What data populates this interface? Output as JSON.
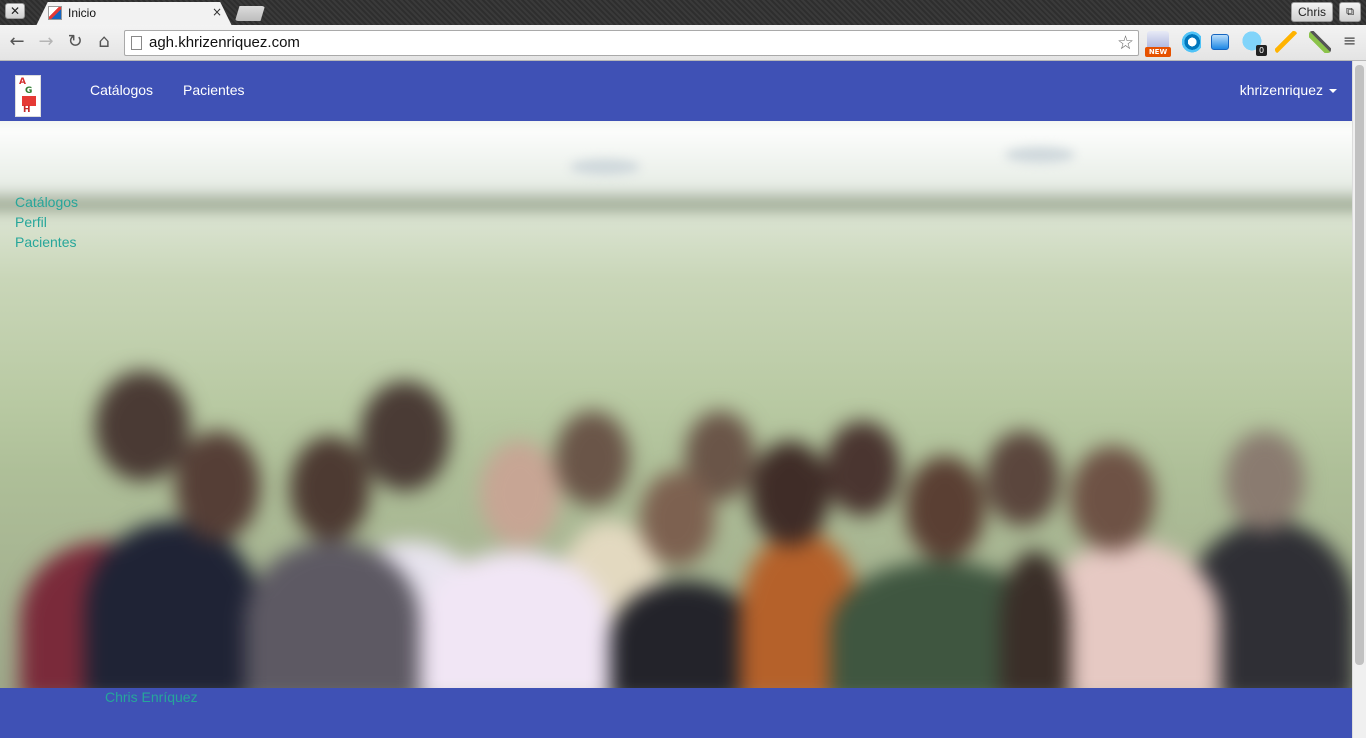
{
  "browser": {
    "tab_title": "Inicio",
    "tab_close_glyph": "×",
    "window_close_glyph": "✕",
    "profile_name": "Chris",
    "url": "agh.khrizenriquez.com",
    "extensions": [
      {
        "name": "new-extension-icon",
        "badge": "NEW"
      },
      {
        "name": "swirl-extension-icon"
      },
      {
        "name": "window-extension-icon"
      },
      {
        "name": "face-extension-icon",
        "badge": "0"
      },
      {
        "name": "tool-extension-icon"
      },
      {
        "name": "eyedropper-extension-icon"
      }
    ]
  },
  "navbar": {
    "brand_logo": {
      "letters": [
        "A",
        "G",
        "H"
      ]
    },
    "links": [
      "Catálogos",
      "Pacientes"
    ],
    "user": "khrizenriquez",
    "color": "#3f51b5"
  },
  "side_links": [
    "Catálogos",
    "Perfil",
    "Pacientes"
  ],
  "hero": {
    "image": "blurred-group-photo"
  },
  "footer": {
    "text": "Chris Enríquez"
  },
  "colors": {
    "primary": "#3f51b5",
    "link": "#26a69a",
    "on_primary": "#ffffff"
  }
}
